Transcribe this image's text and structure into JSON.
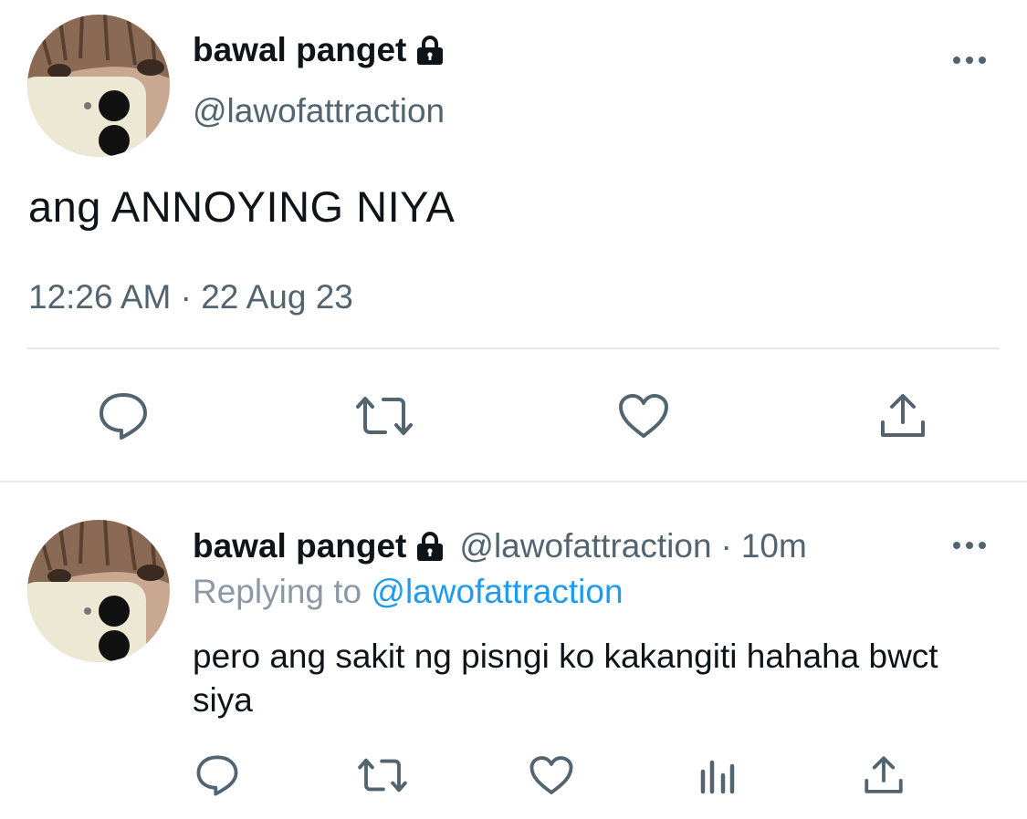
{
  "tweet": {
    "display_name": "bawal panget",
    "handle": "@lawofattraction",
    "text": "ang ANNOYING NIYA",
    "timestamp": "12:26 AM · 22 Aug 23",
    "actions": {
      "reply_icon": "comment-icon",
      "retweet_icon": "retweet-icon",
      "like_icon": "heart-icon",
      "share_icon": "share-icon"
    }
  },
  "reply": {
    "display_name": "bawal panget",
    "handle": "@lawofattraction",
    "separator": "·",
    "time": "10m",
    "replying_to_label": "Replying to",
    "replying_to_handle": "@lawofattraction",
    "text": "pero ang sakit ng pisngi ko kakangiti hahaha bwct siya",
    "actions": {
      "reply_icon": "comment-icon",
      "retweet_icon": "retweet-icon",
      "like_icon": "heart-icon",
      "views_icon": "analytics-icon",
      "share_icon": "share-icon"
    }
  },
  "colors": {
    "primary_text": "#0f1419",
    "secondary_text": "#536471",
    "link": "#1d9bf0",
    "icon": "#536471",
    "divider": "#e6e9eb"
  }
}
